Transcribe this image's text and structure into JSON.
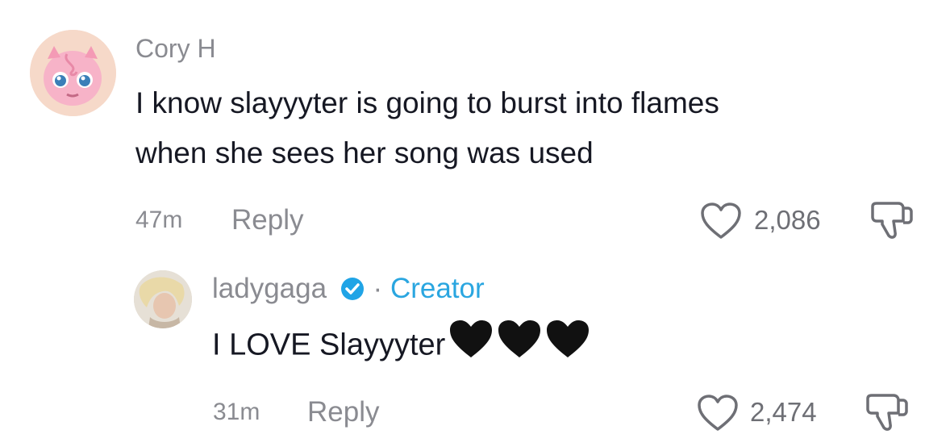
{
  "comments": [
    {
      "username": "Cory H",
      "text_line1": "I know slayyyter is going to burst into flames",
      "text_line2": "when she sees her song was used",
      "time": "47m",
      "reply_label": "Reply",
      "likes": "2,086",
      "avatar_icon": "jigglypuff-avatar"
    },
    {
      "username": "ladygaga",
      "verified_icon": "verified-check-icon",
      "separator": "·",
      "creator_label": "Creator",
      "text": "I LOVE Slayyyter",
      "emoji": [
        "black-heart",
        "black-heart",
        "black-heart"
      ],
      "time": "31m",
      "reply_label": "Reply",
      "likes": "2,474",
      "avatar_icon": "user-photo-avatar"
    }
  ],
  "colors": {
    "muted": "#8a8b91",
    "text": "#161823",
    "creator": "#2aa6e0",
    "verified": "#20a4e6"
  }
}
